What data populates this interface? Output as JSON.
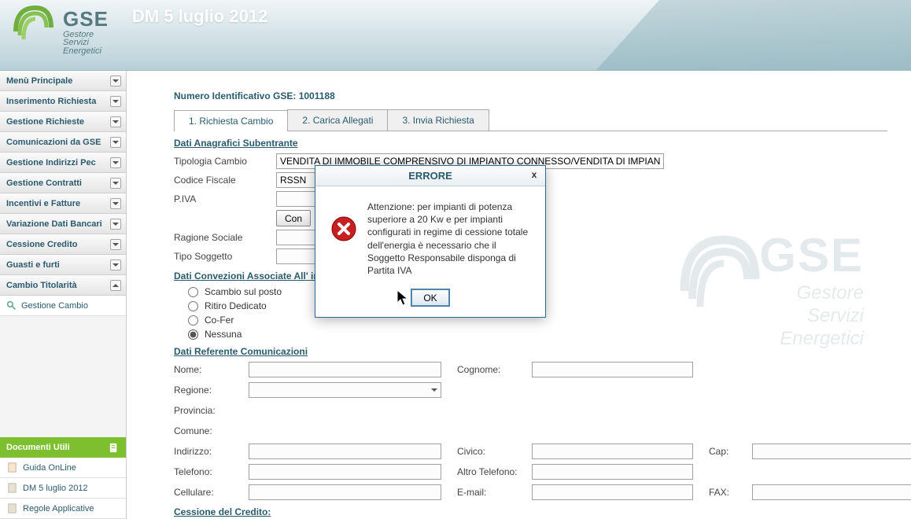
{
  "header": {
    "logo_main": "GSE",
    "logo_sub1": "Gestore",
    "logo_sub2": "Servizi",
    "logo_sub3": "Energetici",
    "title": "DM 5 luglio 2012"
  },
  "sidebar": {
    "items": [
      {
        "label": "Menù Principale"
      },
      {
        "label": "Inserimento Richiesta"
      },
      {
        "label": "Gestione Richieste"
      },
      {
        "label": "Comunicazioni da GSE"
      },
      {
        "label": "Gestione Indirizzi Pec"
      },
      {
        "label": "Gestione Contratti"
      },
      {
        "label": "Incentivi e Fatture"
      },
      {
        "label": "Variazione Dati Bancari"
      },
      {
        "label": "Cessione Credito"
      },
      {
        "label": "Guasti e furti"
      },
      {
        "label": "Cambio Titolarità"
      }
    ],
    "sub": {
      "label": "Gestione Cambio"
    },
    "docs": {
      "title": "Documenti Utili",
      "items": [
        {
          "label": "Guida OnLine"
        },
        {
          "label": "DM 5 luglio 2012"
        },
        {
          "label": "Regole Applicative"
        }
      ]
    }
  },
  "main": {
    "id_label": "Numero Identificativo GSE: 1001188",
    "tabs": [
      {
        "label": "1. Richiesta Cambio",
        "active": true
      },
      {
        "label": "2. Carica Allegati",
        "active": false
      },
      {
        "label": "3. Invia Richiesta",
        "active": false
      }
    ],
    "sec1_title": "Dati Anagrafici Subentrante",
    "fields": {
      "tipologia_label": "Tipologia Cambio",
      "tipologia_value": "VENDITA DI IMMOBILE COMPRENSIVO DI IMPIANTO CONNESSO/VENDITA DI IMPIANTO",
      "cf_label": "Codice Fiscale",
      "cf_value": "RSSN",
      "piva_label": "P.IVA",
      "piva_value": "",
      "conferma_btn": "Con",
      "rs_label": "Ragione Sociale",
      "ts_label": "Tipo Soggetto"
    },
    "sec2_title": "Dati Convezioni Associate All' im",
    "radios": [
      {
        "label": "Scambio sul posto",
        "checked": false
      },
      {
        "label": "Ritiro Dedicato",
        "checked": false
      },
      {
        "label": "Co-Fer",
        "checked": false
      },
      {
        "label": "Nessuna",
        "checked": true
      }
    ],
    "sec3_title": "Dati Referente Comunicazioni",
    "ref": {
      "nome": "Nome:",
      "cognome": "Cognome:",
      "regione": "Regione:",
      "provincia": "Provincia:",
      "comune": "Comune:",
      "indirizzo": "Indirizzo:",
      "civico": "Civico:",
      "cap": "Cap:",
      "telefono": "Telefono:",
      "altro_tel": "Altro Telefono:",
      "cellulare": "Cellulare:",
      "email": "E-mail:",
      "fax": "FAX:"
    },
    "sec4_title": "Cessione del Credito:"
  },
  "modal": {
    "title": "ERRORE",
    "message": "Attenzione: per impianti di potenza superiore a 20 Kw e per impianti configurati in regime di cessione totale dell'energia è necessario che il Soggetto Responsabile disponga di Partita IVA",
    "ok": "OK",
    "close": "x"
  }
}
